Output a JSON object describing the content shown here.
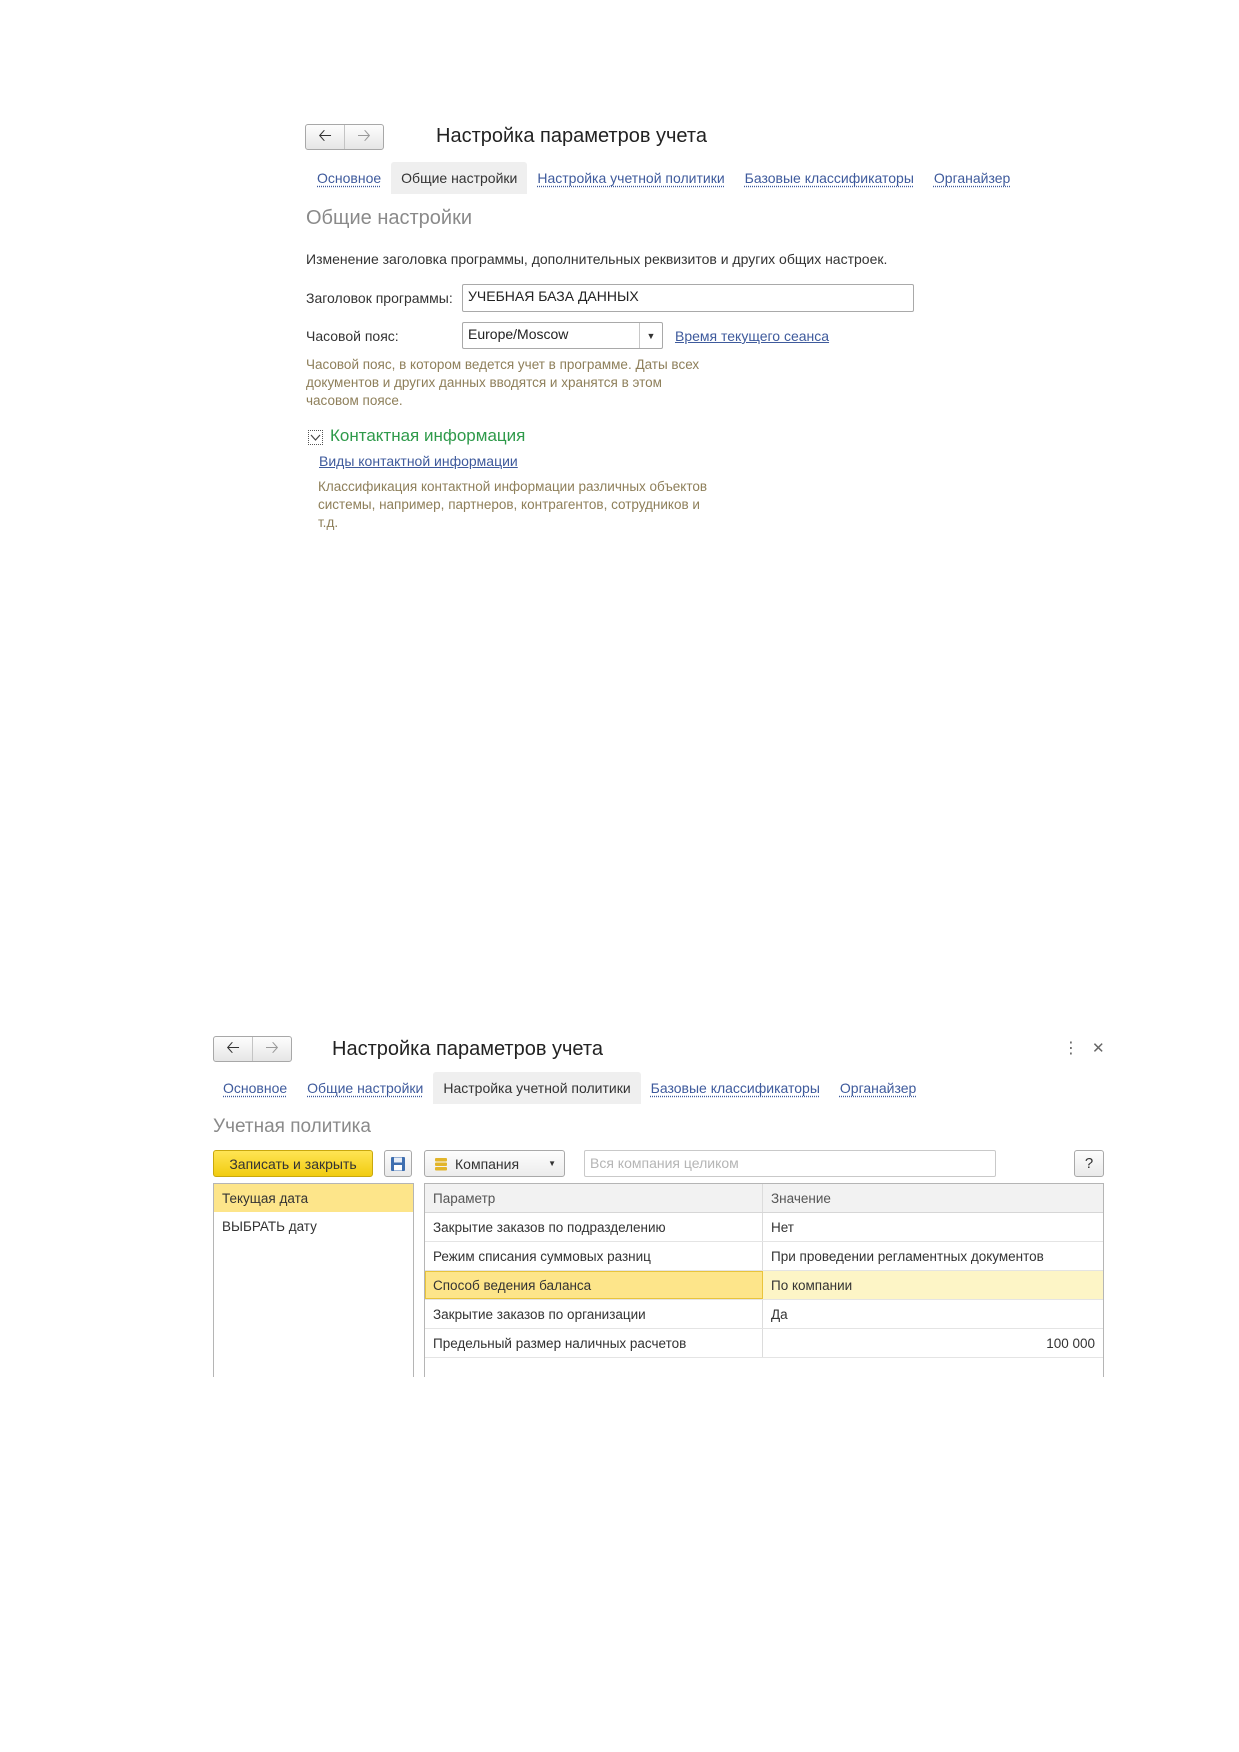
{
  "top_form": {
    "title": "Настройка параметров учета",
    "tabs": [
      {
        "label": "Основное"
      },
      {
        "label": "Общие настройки"
      },
      {
        "label": "Настройка учетной политики"
      },
      {
        "label": "Базовые классификаторы"
      },
      {
        "label": "Органайзер"
      }
    ],
    "active_tab": "Общие настройки",
    "section_title": "Общие настройки",
    "description": "Изменение заголовка программы, дополнительных реквизитов и других общих настроек.",
    "program_title_label": "Заголовок программы:",
    "program_title_value": "УЧЕБНАЯ БАЗА ДАННЫХ",
    "timezone_label": "Часовой пояс:",
    "timezone_value": "Europe/Moscow",
    "session_time_link": "Время текущего сеанса",
    "timezone_hint": [
      "Часовой пояс, в котором ведется учет в программе. Даты всех",
      "документов и других данных вводятся и хранятся в этом",
      "часовом поясе."
    ],
    "contact_group_title": "Контактная информация",
    "contact_kinds_link": "Виды контактной информации",
    "contact_hint": [
      "Классификация контактной информации различных объектов",
      "системы, например, партнеров, контрагентов, сотрудников и",
      "т.д."
    ]
  },
  "bottom_form": {
    "title": "Настройка параметров учета",
    "tabs": [
      {
        "label": "Основное"
      },
      {
        "label": "Общие настройки"
      },
      {
        "label": "Настройка учетной политики"
      },
      {
        "label": "Базовые классификаторы"
      },
      {
        "label": "Органайзер"
      }
    ],
    "active_tab": "Настройка учетной политики",
    "section_title": "Учетная политика",
    "save_close_label": "Записать и закрыть",
    "company_select": "Компания",
    "company_placeholder": "Вся компания целиком",
    "help_label": "?",
    "left_list": [
      {
        "label": "Текущая дата",
        "selected": true
      },
      {
        "label": "ВЫБРАТЬ дату",
        "selected": false
      }
    ],
    "table": {
      "headers": [
        "Параметр",
        "Значение"
      ],
      "rows": [
        {
          "param": "Закрытие заказов по подразделению",
          "value": "Нет"
        },
        {
          "param": "Режим списания суммовых разниц",
          "value": "При проведении регламентных документов"
        },
        {
          "param": "Способ ведения баланса",
          "value": "По компании",
          "selected": true
        },
        {
          "param": "Закрытие заказов по организации",
          "value": "Да"
        },
        {
          "param": "Предельный размер наличных расчетов",
          "value": "100 000"
        }
      ]
    }
  },
  "colors": {
    "link": "#3e5a9c",
    "hint": "#8e7f5a",
    "group_title": "#2e9a4a",
    "accent_yellow": "#f1cc10",
    "selection": "#fde58a"
  }
}
